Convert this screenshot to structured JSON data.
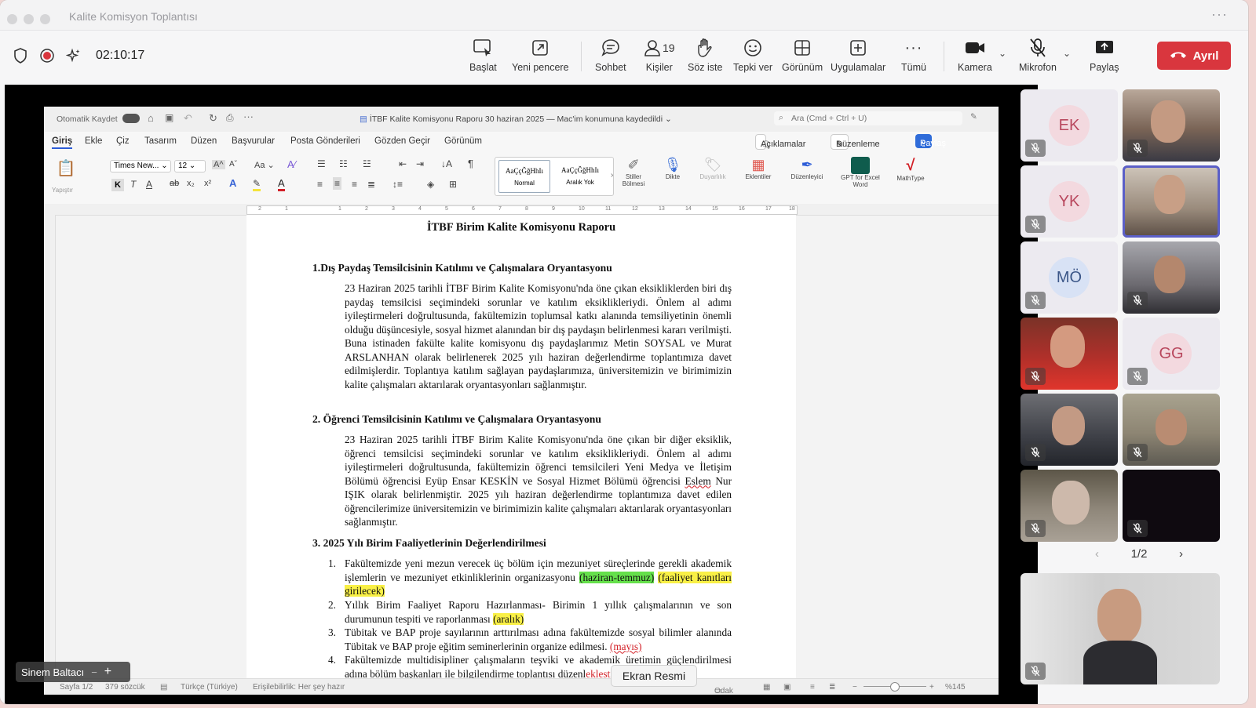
{
  "window": {
    "title": "Kalite Komisyon Toplantısı"
  },
  "meeting": {
    "timer": "02:10:17",
    "toolbar": [
      {
        "id": "baslat",
        "label": "Başlat",
        "icon": "presenter-icon"
      },
      {
        "id": "yeni-pencere",
        "label": "Yeni pencere",
        "icon": "popout-icon"
      },
      {
        "id": "sohbet",
        "label": "Sohbet",
        "icon": "chat-icon"
      },
      {
        "id": "kisiler",
        "label": "Kişiler",
        "icon": "people-icon",
        "count": "19"
      },
      {
        "id": "soz-iste",
        "label": "Söz iste",
        "icon": "raise-hand-icon"
      },
      {
        "id": "tepki-ver",
        "label": "Tepki ver",
        "icon": "emoji-icon"
      },
      {
        "id": "gorunum",
        "label": "Görünüm",
        "icon": "grid-view-icon"
      },
      {
        "id": "uygulamalar",
        "label": "Uygulamalar",
        "icon": "apps-plus-icon"
      },
      {
        "id": "tumu",
        "label": "Tümü",
        "icon": "more-icon"
      },
      {
        "id": "kamera",
        "label": "Kamera",
        "icon": "camera-icon"
      },
      {
        "id": "mikrofon",
        "label": "Mikrofon",
        "icon": "mic-muted-icon"
      },
      {
        "id": "paylas",
        "label": "Paylaş",
        "icon": "share-screen-icon"
      }
    ],
    "leave_label": "Ayrıl",
    "presenter_name": "Sinem Baltacı",
    "tooltip": "Ekran Resmi",
    "pager": "1/2",
    "participants": [
      {
        "initials": "EK",
        "type": "avatar",
        "avatar_bg": "#f3d9df",
        "color": "#b8475d"
      },
      {
        "type": "video",
        "desc": "man-glasses-video"
      },
      {
        "initials": "YK",
        "type": "avatar",
        "avatar_bg": "#f3d9df",
        "color": "#b8475d"
      },
      {
        "type": "video",
        "desc": "woman-video-active"
      },
      {
        "initials": "MÖ",
        "type": "avatar",
        "avatar_bg": "#d8e2f5",
        "color": "#3b5688"
      },
      {
        "type": "video",
        "desc": "man-beard-video"
      },
      {
        "type": "video",
        "desc": "woman-red-video"
      },
      {
        "initials": "GG",
        "type": "avatar",
        "avatar_bg": "#f3d9df",
        "color": "#b8475d"
      },
      {
        "type": "video",
        "desc": "man-headphones-video"
      },
      {
        "type": "video",
        "desc": "older-man-video"
      },
      {
        "type": "video",
        "desc": "grey-hair-woman-video"
      },
      {
        "type": "video",
        "desc": "dark-video"
      }
    ]
  },
  "word": {
    "autosave_label": "Otomatik Kaydet",
    "doc_title": "İTBF Kalite Komisyonu Raporu 30 haziran 2025 — Mac'im konumuna kaydedildi",
    "search_placeholder": "Ara (Cmd + Ctrl + U)",
    "tabs": [
      "Giriş",
      "Ekle",
      "Çiz",
      "Tasarım",
      "Düzen",
      "Başvurular",
      "Posta Gönderileri",
      "Gözden Geçir",
      "Görünüm"
    ],
    "comments_label": "Açıklamalar",
    "editing_label": "Düzenleme",
    "share_label": "Paylaş",
    "font_name": "Times New...",
    "font_size": "12",
    "paste_label": "Yapıştır",
    "style_sample": "AaÇçĞğHhIı",
    "style_normal": "Normal",
    "style_nospace": "Aralık Yok",
    "ribbon_buttons": [
      "Stiller Bölmesi",
      "Dikte",
      "Duyarlılık",
      "Eklentiler",
      "Düzenleyici",
      "GPT for Excel Word",
      "MathType"
    ],
    "ruler_numbers": [
      "2",
      "1",
      "1",
      "2",
      "3",
      "4",
      "5",
      "6",
      "7",
      "8",
      "9",
      "10",
      "11",
      "12",
      "13",
      "14",
      "15",
      "16",
      "17",
      "18"
    ],
    "status": {
      "page": "Sayfa 1/2",
      "words": "379 sözcük",
      "language": "Türkçe (Türkiye)",
      "accessibility": "Erişilebilirlik: Her şey hazır",
      "focus": "Odak",
      "zoom": "%145"
    }
  },
  "document": {
    "title": "İTBF Birim Kalite Komisyonu Raporu",
    "s1_heading": "1.Dış Paydaş Temsilcisinin Katılımı ve Çalışmalara Oryantasyonu",
    "s1_body": "23 Haziran 2025 tarihli İTBF Birim Kalite Komisyonu'nda öne çıkan eksikliklerden biri dış paydaş temsilcisi seçimindeki sorunlar ve katılım eksiklikleriydi. Önlem al adımı iyileştirmeleri doğrultusunda, fakültemizin toplumsal katkı alanında temsiliyetinin önemli olduğu düşüncesiyle, sosyal hizmet alanından bir dış paydaşın belirlenmesi kararı verilmişti. Buna istinaden fakülte kalite komisyonu dış paydaşlarımız Metin SOYSAL ve Murat ARSLANHAN olarak belirlenerek 2025 yılı haziran değerlendirme toplantımıza davet edilmişlerdir. Toplantıya katılım sağlayan paydaşlarımıza, üniversitemizin ve birimimizin kalite çalışmaları aktarılarak oryantasyonları sağlanmıştır.",
    "s2_heading": "2. Öğrenci Temsilcisinin Katılımı ve Çalışmalara Oryantasyonu",
    "s2_body_a": "23 Haziran 2025 tarihli İTBF Birim Kalite Komisyonu'nda öne çıkan bir diğer eksiklik, öğrenci temsilcisi seçimindeki sorunlar ve katılım eksiklikleriydi. Önlem al adımı iyileştirmeleri doğrultusunda, fakültemizin öğrenci temsilcileri Yeni Medya ve İletişim Bölümü öğrencisi Eyüp Ensar KESKİN ve Sosyal Hizmet Bölümü öğrencisi ",
    "s2_body_squiggle": "Eslem",
    "s2_body_b": " Nur IŞIK olarak belirlenmiştir. 2025 yılı haziran değerlendirme toplantımıza davet edilen öğrencilerimize üniversitemizin ve birimimizin kalite çalışmaları aktarılarak oryantasyonları sağlanmıştır.",
    "s3_heading": "3. 2025 Yılı Birim Faaliyetlerinin Değerlendirilmesi",
    "items": [
      {
        "num": "1.",
        "text": "Fakültemizde yeni mezun verecek üç bölüm için mezuniyet süreçlerinde gerekli akademik işlemlerin ve mezuniyet etkinliklerinin organizasyonu ",
        "hl_green": "(haziran-temmuz)",
        "hl_yellow": "(faaliyet kanıtları girilecek)"
      },
      {
        "num": "2.",
        "text": "Yıllık Birim Faaliyet Raporu Hazırlanması- Birimin 1 yıllık çalışmalarının ve son durumunun tespiti ve raporlanması ",
        "hl_yellow": "(aralık)"
      },
      {
        "num": "3.",
        "text": "Tübitak ve BAP proje sayılarının arttırılması adına fakültemizde sosyal bilimler alanında Tübitak ve BAP proje eğitim seminerlerinin organize edilmesi. ",
        "red": "(mayıs)"
      },
      {
        "num": "4.",
        "text": "Fakültemizde multidisipliner çalışmaların teşviki ve akademik üretimin güçlendirilmesi adına bölüm başkanları ile bilgilendirme toplantısı düzenl",
        "red": "eklesti"
      }
    ]
  }
}
